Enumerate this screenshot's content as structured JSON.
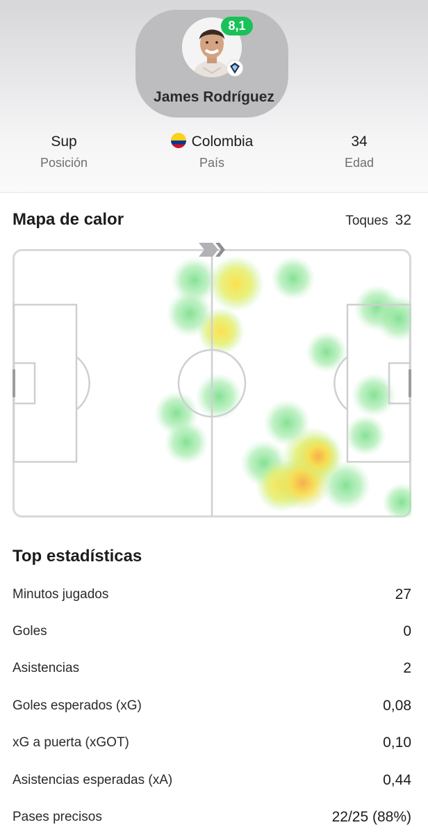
{
  "player": {
    "name": "James Rodríguez",
    "rating": "8,1",
    "rating_color": "#19c158"
  },
  "info": {
    "position_value": "Sup",
    "position_label": "Posición",
    "country_value": "Colombia",
    "country_label": "País",
    "age_value": "34",
    "age_label": "Edad",
    "flag_icon": "colombia-flag-icon"
  },
  "heatmap": {
    "title": "Mapa de calor",
    "touches_label": "Toques",
    "touches_value": "32",
    "direction_icon": "attack-direction-arrow-icon"
  },
  "stats": {
    "title": "Top estadísticas",
    "rows": [
      {
        "label": "Minutos jugados",
        "value": "27"
      },
      {
        "label": "Goles",
        "value": "0"
      },
      {
        "label": "Asistencias",
        "value": "2"
      },
      {
        "label": "Goles esperados (xG)",
        "value": "0,08"
      },
      {
        "label": "xG a puerta (xGOT)",
        "value": "0,10"
      },
      {
        "label": "Asistencias esperadas (xA)",
        "value": "0,44"
      },
      {
        "label": "Pases precisos",
        "value": "22/25 (88%)"
      }
    ]
  }
}
